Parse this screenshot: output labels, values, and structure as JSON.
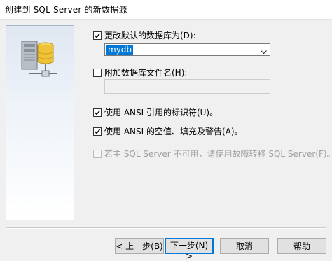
{
  "window": {
    "title": "创建到 SQL Server 的新数据源"
  },
  "options": {
    "change_default_db": {
      "label": "更改默认的数据库为(D):",
      "checked": true
    },
    "database_combo": {
      "value": "mydb"
    },
    "attach_db_file": {
      "label": "附加数据库文件名(H):",
      "checked": false
    },
    "attach_file_path": {
      "value": ""
    },
    "ansi_quoted_identifiers": {
      "label": "使用 ANSI 引用的标识符(U)。",
      "checked": true
    },
    "ansi_nulls_padding_warnings": {
      "label": "使用 ANSI 的空值、填充及警告(A)。",
      "checked": true
    },
    "failover_server": {
      "label": "若主 SQL Server 不可用，请使用故障转移 SQL Server(F)。",
      "checked": false,
      "enabled": false
    }
  },
  "buttons": {
    "back": "< 上一步(B)",
    "next": "下一步(N) >",
    "cancel": "取消",
    "help": "帮助"
  },
  "icons": {
    "panel": "database-server-icon",
    "combo_arrow": "chevron-down-icon",
    "check": "checkmark-icon"
  },
  "colors": {
    "accent": "#0078d7",
    "selection": "#0078d7",
    "disabled_text": "#a0a0a0"
  }
}
